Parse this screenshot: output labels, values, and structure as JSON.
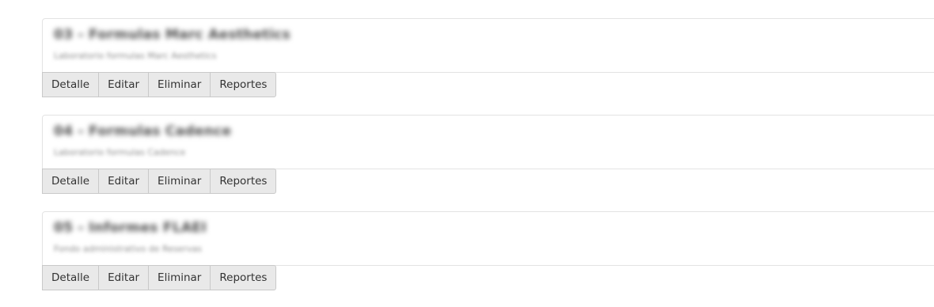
{
  "items": [
    {
      "title": "03 - Formulas Marc Aesthetics",
      "subtitle": "Laboratorio formulas Marc Aesthetics",
      "buttons": [
        "Detalle",
        "Editar",
        "Eliminar",
        "Reportes"
      ]
    },
    {
      "title": "04 - Formulas Cadence",
      "subtitle": "Laboratorio formulas Cadence",
      "buttons": [
        "Detalle",
        "Editar",
        "Eliminar",
        "Reportes"
      ]
    },
    {
      "title": "05 - Informes FLAEI",
      "subtitle": "Fondo administrativo de Reservas",
      "buttons": [
        "Detalle",
        "Editar",
        "Eliminar",
        "Reportes"
      ]
    }
  ]
}
